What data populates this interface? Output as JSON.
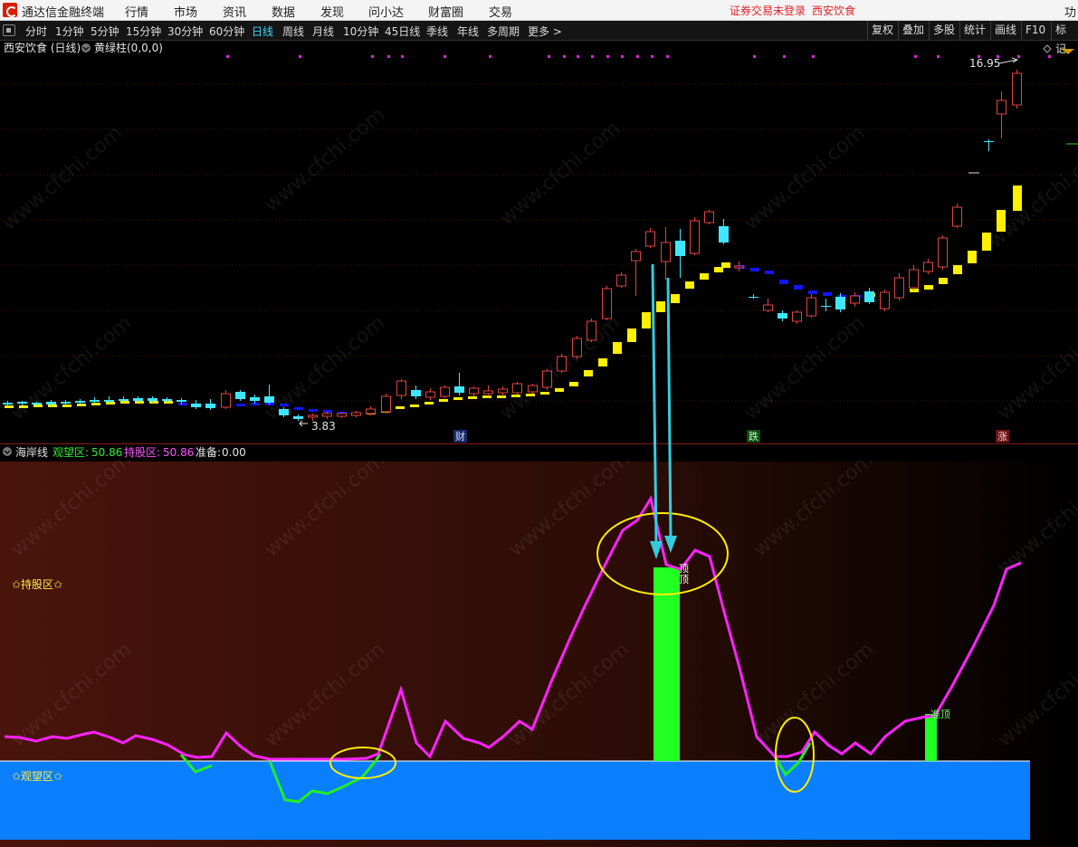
{
  "menubar": {
    "app_title": "通达信金融终端",
    "items": [
      "行情",
      "市场",
      "资讯",
      "数据",
      "发现",
      "问小达",
      "财富圈",
      "交易"
    ],
    "login_status": "证券交易未登录",
    "stock_name": "西安饮食",
    "cut_text": "功"
  },
  "toolbar": {
    "periods": [
      "分时",
      "1分钟",
      "5分钟",
      "15分钟",
      "30分钟",
      "60分钟",
      "日线",
      "周线",
      "月线",
      "10分钟",
      "45日线",
      "季线",
      "年线",
      "多周期",
      "更多 >"
    ],
    "active_period": "日线",
    "tools": [
      "复权",
      "叠加",
      "多股",
      "统计",
      "画线",
      "F10",
      "标记"
    ]
  },
  "price_panel": {
    "title": "西安饮食 (日线)",
    "indicator": "黄绿柱(0,0,0)",
    "high_label": "16.95",
    "low_label": "3.83",
    "event_markers": [
      "财",
      "跌",
      "涨"
    ]
  },
  "indicator_panel": {
    "name": "海岸线",
    "watch_label": "观望区:",
    "watch_value": "50.86",
    "hold_label": "持股区:",
    "hold_value": "50.86",
    "ready_label": "准备:",
    "ready_value": "0.00",
    "hold_zone_text": "✩持股区✩",
    "watch_zone_text": "✩观望区✩",
    "top_label_1": "顶",
    "top_label_2": "顶",
    "top_label_3": "准顶"
  },
  "watermark": "www.cfchi.com",
  "colors": {
    "up": "#e0463f",
    "down": "#3fe6ff",
    "yellow_bar": "#ffef00",
    "blue_bar": "#1414ff",
    "line_magenta": "#ff22ff",
    "line_green": "#22ee22",
    "green_bar": "#22ff22",
    "watch_zone": "#0a7fff",
    "ellipse": "#ffee00",
    "arrow": "#33ccdd"
  }
}
